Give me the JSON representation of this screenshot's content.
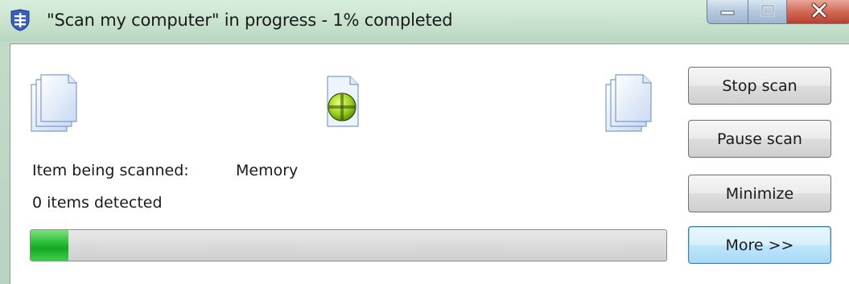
{
  "window": {
    "title": "\"Scan my computer\" in progress - 1% completed",
    "app_icon": "shield-app-icon",
    "caption_icons": [
      "minimize-icon",
      "maximize-icon",
      "close-icon"
    ]
  },
  "scan": {
    "item_label": "Item being scanned:",
    "item_value": "Memory",
    "detected_text": "0 items detected",
    "progress_percent": 1,
    "progress_fill_fraction": 0.06,
    "icons": [
      "document-stack-icon",
      "scan-target-icon",
      "document-stack-icon"
    ]
  },
  "buttons": {
    "stop": "Stop scan",
    "pause": "Pause scan",
    "minimize": "Minimize",
    "more": "More >>"
  },
  "colors": {
    "titlebar": "#c8e2cc",
    "progress_fill": "#1fb52b",
    "close_button": "#c9503b",
    "default_button_border": "#3c7fb1"
  }
}
